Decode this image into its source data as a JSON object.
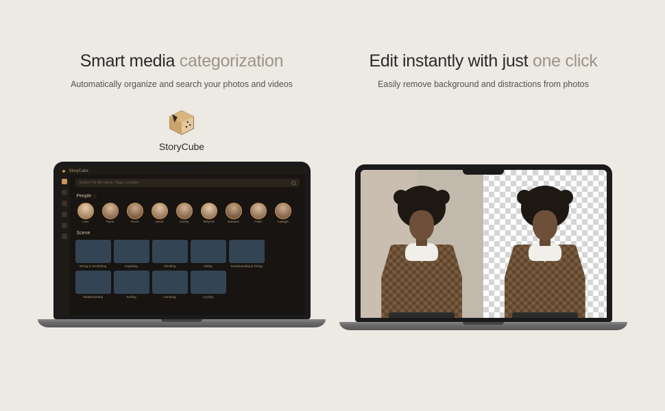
{
  "left": {
    "title_a": "Smart media ",
    "title_b": "categorization",
    "subtitle": "Automatically organize and search your photos and videos",
    "brand": "StoryCube"
  },
  "right": {
    "title_a": "Edit instantly with just ",
    "title_b": "one click",
    "subtitle": "Easily remove background and distractions from photos"
  },
  "app": {
    "title": "StoryCube",
    "search_placeholder": "Search for file name, Tags, Location",
    "sections": {
      "people": "People",
      "scene": "Scene"
    },
    "people": [
      {
        "name": "Lisa"
      },
      {
        "name": "Flynn"
      },
      {
        "name": "Kevin"
      },
      {
        "name": "Jason"
      },
      {
        "name": "Candy"
      },
      {
        "name": "Whynot"
      },
      {
        "name": "Edward"
      },
      {
        "name": "Fetts"
      },
      {
        "name": "Caleigh"
      }
    ],
    "scenes": [
      {
        "name": "Diving & Snorkeling"
      },
      {
        "name": "Kayaking"
      },
      {
        "name": "Climbing"
      },
      {
        "name": "Hiking"
      },
      {
        "name": "Snowboarding & Skiing"
      },
      {
        "name": "Skateboarding"
      },
      {
        "name": "Surfing"
      },
      {
        "name": "Camping"
      },
      {
        "name": "Cycling"
      }
    ]
  }
}
